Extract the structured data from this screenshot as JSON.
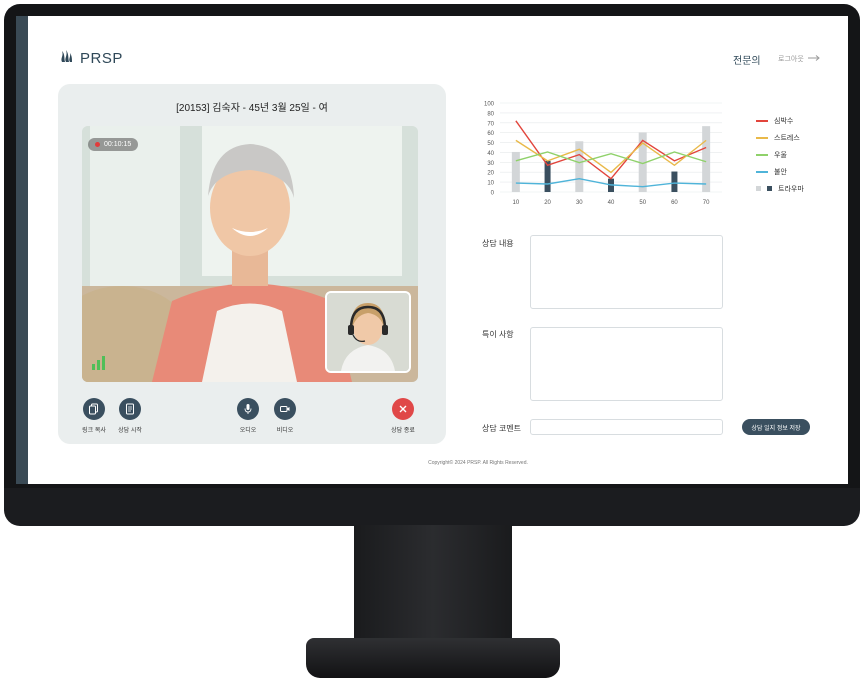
{
  "app": {
    "brand": "PRSP",
    "nav": {
      "expert": "전문의",
      "logout": "로그아웃"
    }
  },
  "patient": {
    "title": "[20153] 김숙자 - 45년 3월 25일 - 여"
  },
  "call": {
    "timer": "00:10:15"
  },
  "controls": {
    "copy_link": "링크 복사",
    "start_consult": "상담 시작",
    "audio": "오디오",
    "video": "비디오",
    "end_consult": "상담 종료"
  },
  "chart_data": {
    "type": "line",
    "categories": [
      10,
      20,
      30,
      40,
      50,
      60,
      70
    ],
    "ylim": [
      0,
      100
    ],
    "yticks": [
      "0",
      "10",
      "20",
      "30",
      "40",
      "50",
      "60",
      "70",
      "80",
      "100"
    ],
    "series": [
      {
        "name": "심박수",
        "kind": "line",
        "color": "#e2453c",
        "values": [
          80,
          30,
          42,
          15,
          58,
          35,
          50
        ]
      },
      {
        "name": "스트레스",
        "kind": "line",
        "color": "#e9b949",
        "values": [
          58,
          35,
          48,
          22,
          55,
          30,
          58
        ]
      },
      {
        "name": "우울",
        "kind": "line",
        "color": "#8fd16a",
        "values": [
          35,
          45,
          33,
          43,
          32,
          45,
          34
        ]
      },
      {
        "name": "불안",
        "kind": "line",
        "color": "#4fb4d9",
        "values": [
          10,
          9,
          15,
          8,
          6,
          10,
          9
        ]
      },
      {
        "name": "트라우마",
        "kind": "bar",
        "color": "#3a4f5f",
        "values": [
          0,
          35,
          0,
          15,
          0,
          23,
          0
        ]
      }
    ],
    "background_bars": {
      "color": "#d3d6d8",
      "values": [
        45,
        0,
        57,
        0,
        67,
        0,
        74
      ]
    }
  },
  "form": {
    "content_label": "상담 내용",
    "special_label": "특이 사항",
    "comment_label": "상담 코멘트",
    "save_label": "상담 일지 정보 저장"
  },
  "footer": {
    "copyright": "Copyright© 2024 PRSP. All Rights Reserved."
  }
}
